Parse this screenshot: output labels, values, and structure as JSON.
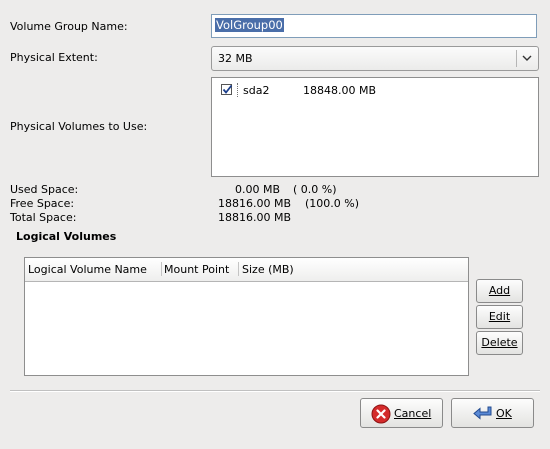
{
  "form": {
    "vg_name_label": "Volume Group Name:",
    "vg_name_value": "VolGroup00",
    "pe_label": "Physical Extent:",
    "pe_value": "32 MB",
    "pv_label": "Physical Volumes to Use:",
    "pv_list": [
      {
        "checked": true,
        "device": "sda2",
        "size": "18848.00 MB"
      }
    ]
  },
  "space": {
    "used_label": "Used Space:",
    "used_value": "0.00 MB",
    "used_pct": "( 0.0 %)",
    "free_label": "Free Space:",
    "free_value": "18816.00 MB",
    "free_pct": "(100.0 %)",
    "total_label": "Total Space:",
    "total_value": "18816.00 MB"
  },
  "lv": {
    "section_title": "Logical Volumes",
    "columns": [
      "Logical Volume Name",
      "Mount Point",
      "Size (MB)"
    ],
    "rows": [],
    "add_label": "Add",
    "edit_label": "Edit",
    "delete_label": "Delete"
  },
  "dialog": {
    "cancel_label": "Cancel",
    "ok_label": "OK"
  },
  "icons": {
    "cancel_icon": "red-x-circle-icon",
    "ok_icon": "blue-enter-arrow-icon",
    "combo_icon": "chevron-down-icon",
    "check_icon": "checkmark-icon"
  }
}
